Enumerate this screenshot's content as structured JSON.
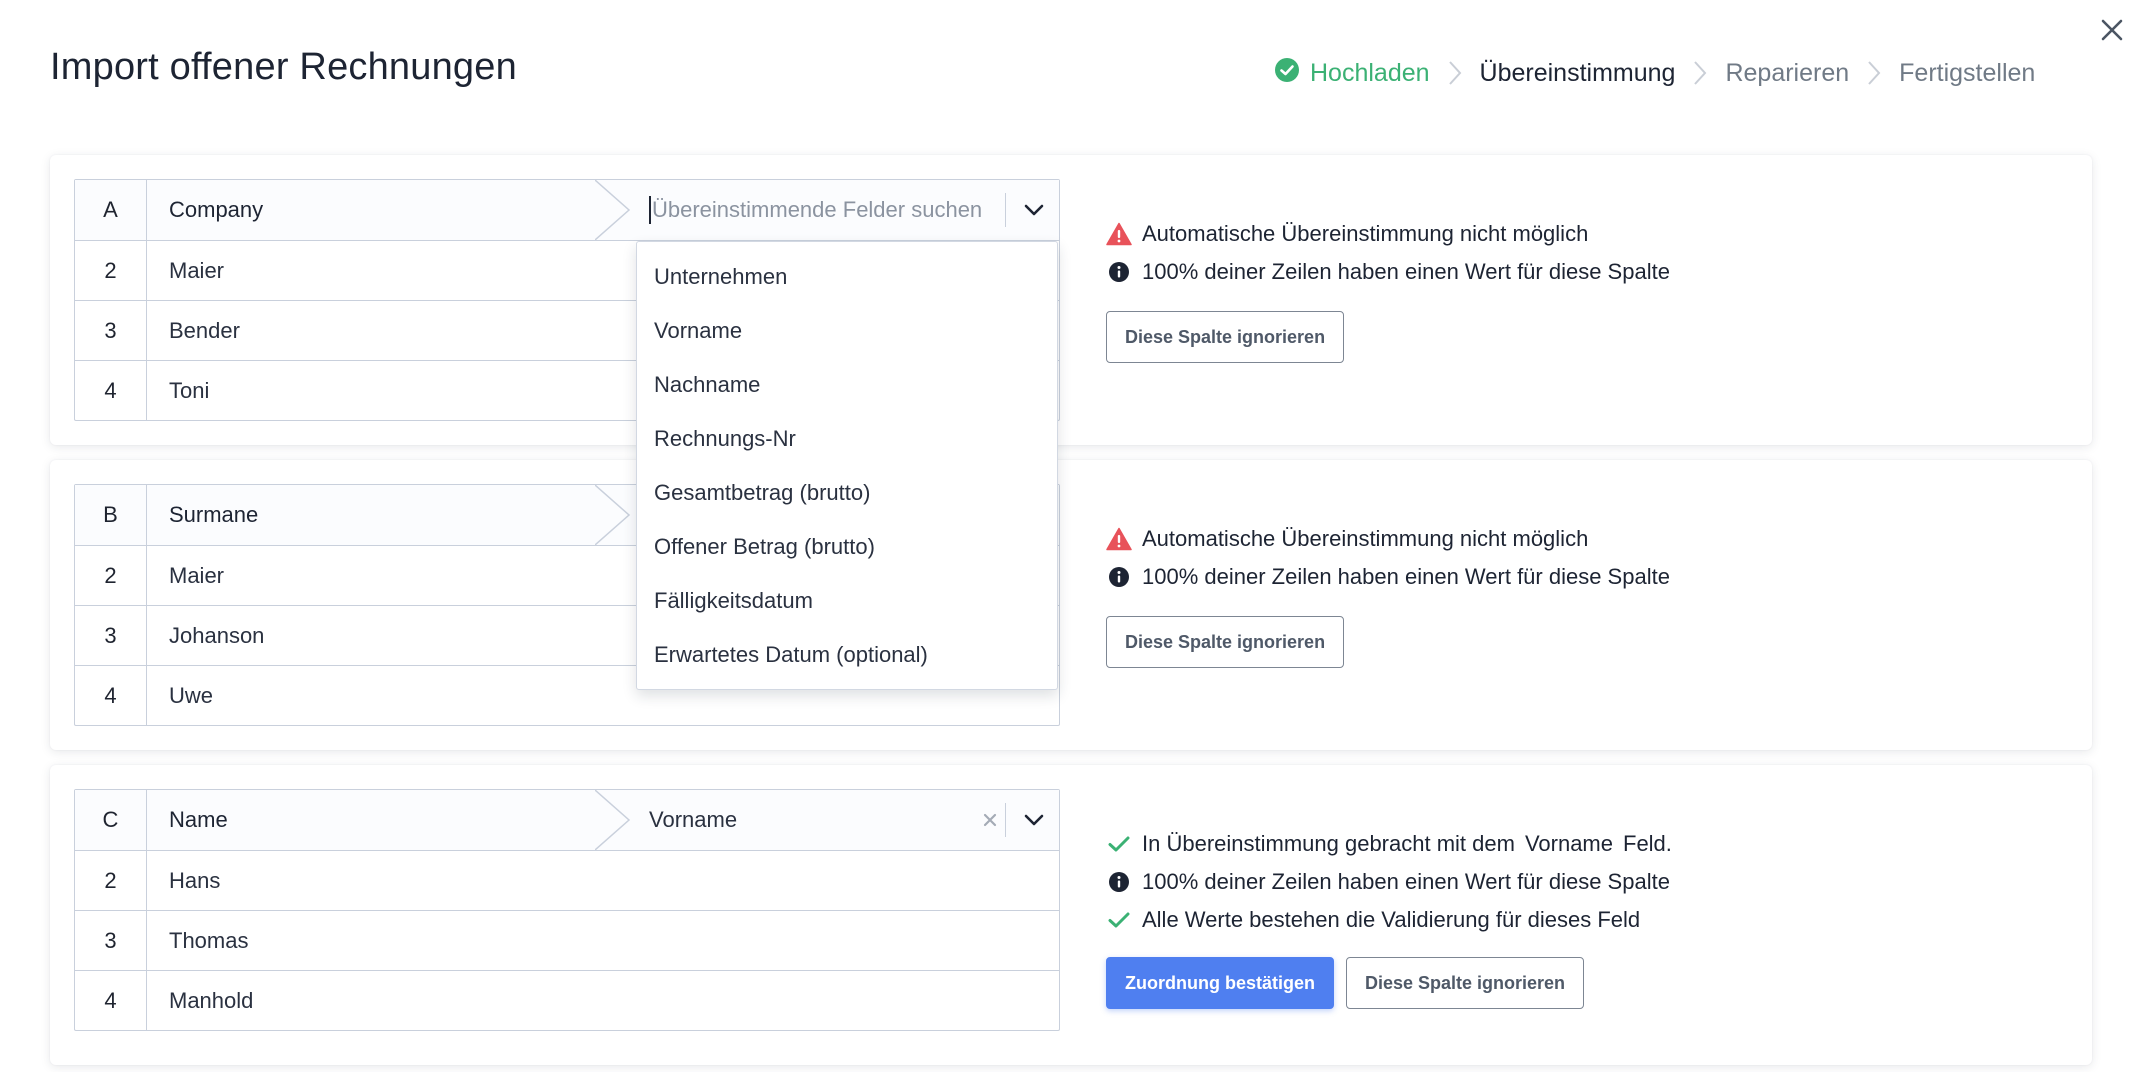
{
  "title": "Import offener Rechnungen",
  "steps": [
    {
      "label": "Hochladen",
      "state": "done"
    },
    {
      "label": "Übereinstimmung",
      "state": "active"
    },
    {
      "label": "Reparieren",
      "state": "todo"
    },
    {
      "label": "Fertigstellen",
      "state": "todo"
    }
  ],
  "colors": {
    "success": "#3bb174",
    "warning": "#e8525a",
    "primary": "#4f7ff0",
    "text": "#1d2433"
  },
  "columns": [
    {
      "letter": "A",
      "header": "Company",
      "rows": [
        {
          "num": "2",
          "value": "Maier"
        },
        {
          "num": "3",
          "value": "Bender"
        },
        {
          "num": "4",
          "value": "Toni"
        }
      ],
      "match_placeholder": "Übereinstimmende Felder suchen",
      "status": "Automatische Übereinstimmung nicht möglich",
      "fill_info": "100% deiner Zeilen haben einen Wert für diese Spalte",
      "ignore_label": "Diese Spalte ignorieren"
    },
    {
      "letter": "B",
      "header": "Surmane",
      "rows": [
        {
          "num": "2",
          "value": "Maier"
        },
        {
          "num": "3",
          "value": "Johanson"
        },
        {
          "num": "4",
          "value": "Uwe"
        }
      ],
      "status": "Automatische Übereinstimmung nicht möglich",
      "fill_info": "100% deiner Zeilen haben einen Wert für diese Spalte",
      "ignore_label": "Diese Spalte ignorieren"
    },
    {
      "letter": "C",
      "header": "Name",
      "rows": [
        {
          "num": "2",
          "value": "Hans"
        },
        {
          "num": "3",
          "value": "Thomas"
        },
        {
          "num": "4",
          "value": "Manhold"
        }
      ],
      "match_value": "Vorname",
      "status_prefix": "In Übereinstimmung gebracht mit dem",
      "status_field": "Vorname",
      "status_suffix": "Feld.",
      "fill_info": "100% deiner Zeilen haben einen Wert für diese Spalte",
      "validation_info": "Alle Werte bestehen die Validierung für dieses Feld",
      "confirm_label": "Zuordnung bestätigen",
      "ignore_label": "Diese Spalte ignorieren"
    }
  ],
  "dropdown": {
    "options": [
      "Unternehmen",
      "Vorname",
      "Nachname",
      "Rechnungs-Nr",
      "Gesamtbetrag (brutto)",
      "Offener Betrag (brutto)",
      "Fälligkeitsdatum",
      "Erwartetes Datum (optional)"
    ]
  }
}
